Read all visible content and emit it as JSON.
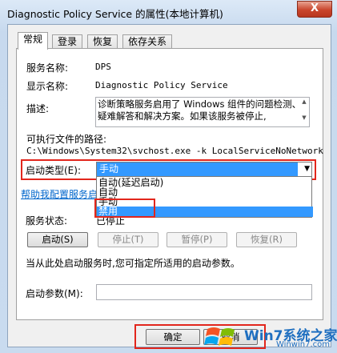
{
  "window": {
    "title": "Diagnostic Policy Service 的属性(本地计算机)",
    "close_label": "X"
  },
  "tabs": [
    "常规",
    "登录",
    "恢复",
    "依存关系"
  ],
  "general": {
    "service_name_label": "服务名称:",
    "service_name": "DPS",
    "display_name_label": "显示名称:",
    "display_name": "Diagnostic Policy Service",
    "description_label": "描述:",
    "description": "诊断策略服务启用了 Windows 组件的问题检测、疑难解答和解决方案。如果该服务被停止,",
    "exe_path_label": "可执行文件的路径:",
    "exe_path": "C:\\Windows\\System32\\svchost.exe -k LocalServiceNoNetwork",
    "startup_type_label": "启动类型(E):",
    "startup_type_value": "手动",
    "startup_options": [
      "自动(延迟启动)",
      "自动",
      "手动",
      "禁用"
    ],
    "help_link": "帮助我配置服务启",
    "service_status_label": "服务状态:",
    "service_status_value": "已停止",
    "buttons": {
      "start": "启动(S)",
      "stop": "停止(T)",
      "pause": "暂停(P)",
      "resume": "恢复(R)"
    },
    "hint": "当从此处启动服务时,您可指定所适用的启动参数。",
    "start_params_label": "启动参数(M):"
  },
  "footer": {
    "ok": "确定",
    "cancel": "取消"
  },
  "watermark": {
    "brand": "Win7系统之家",
    "url": "Winwin7.com"
  },
  "colors": {
    "highlight": "#3399ff",
    "annotation": "#e2261c",
    "link": "#0066cc"
  }
}
